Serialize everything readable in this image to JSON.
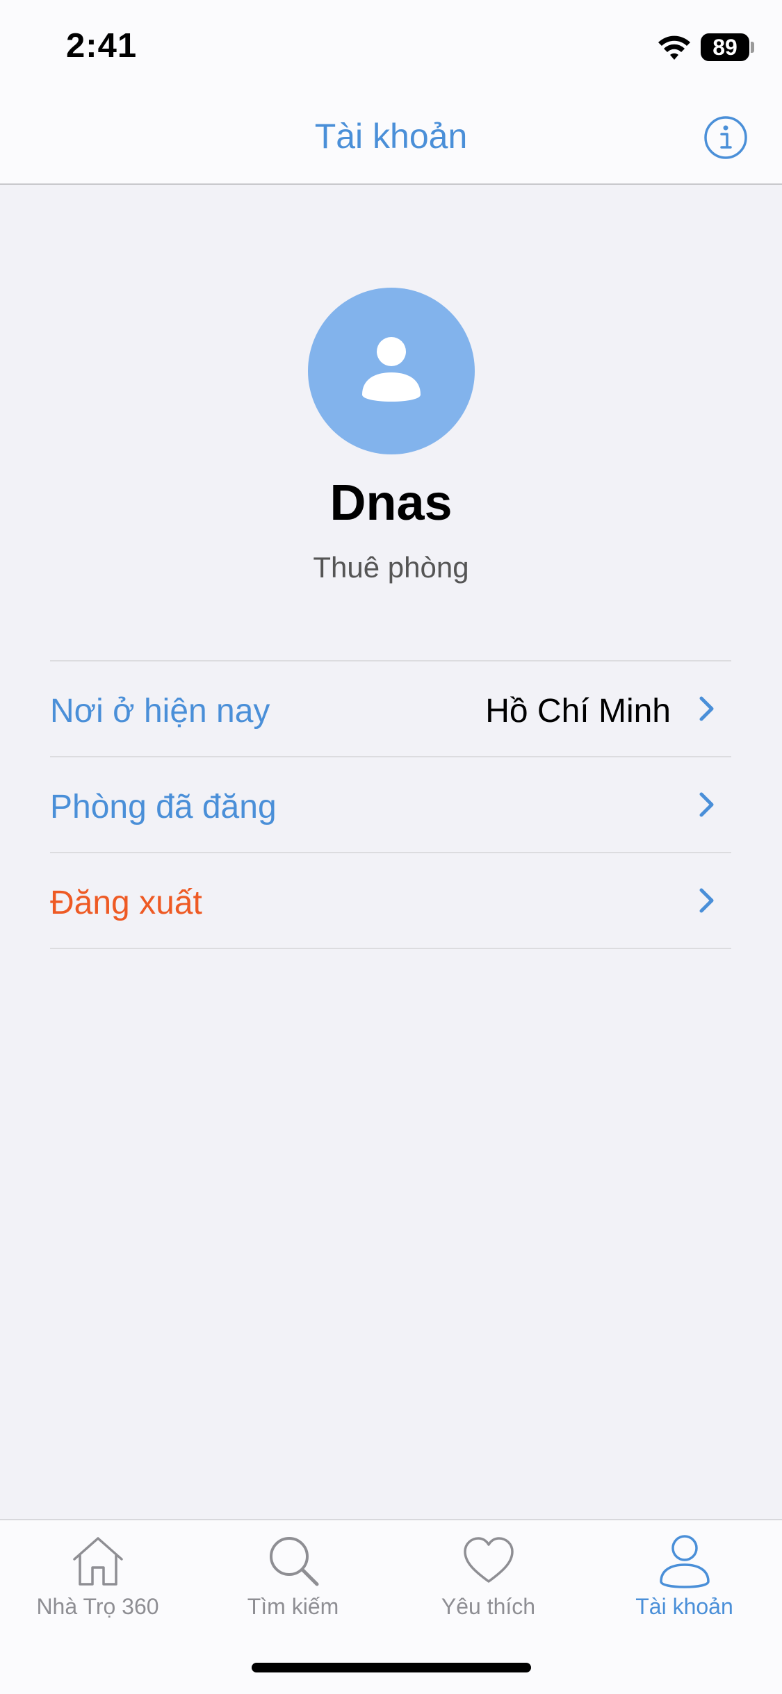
{
  "status_bar": {
    "time": "2:41",
    "battery": "89"
  },
  "nav": {
    "title": "Tài khoản"
  },
  "profile": {
    "name": "Dnas",
    "role": "Thuê phòng"
  },
  "menu": [
    {
      "label": "Nơi ở hiện nay",
      "value": "Hồ Chí Minh"
    },
    {
      "label": "Phòng đã đăng",
      "value": ""
    },
    {
      "label": "Đăng xuất",
      "value": ""
    }
  ],
  "tabs": [
    {
      "label": "Nhà Trọ 360",
      "icon": "house-icon"
    },
    {
      "label": "Tìm kiếm",
      "icon": "search-icon"
    },
    {
      "label": "Yêu thích",
      "icon": "heart-icon"
    },
    {
      "label": "Tài khoản",
      "icon": "person-icon"
    }
  ],
  "colors": {
    "accent": "#4a8fd8",
    "danger": "#ee5a24",
    "avatar_bg": "#82b3ec",
    "background": "#f2f2f7"
  }
}
